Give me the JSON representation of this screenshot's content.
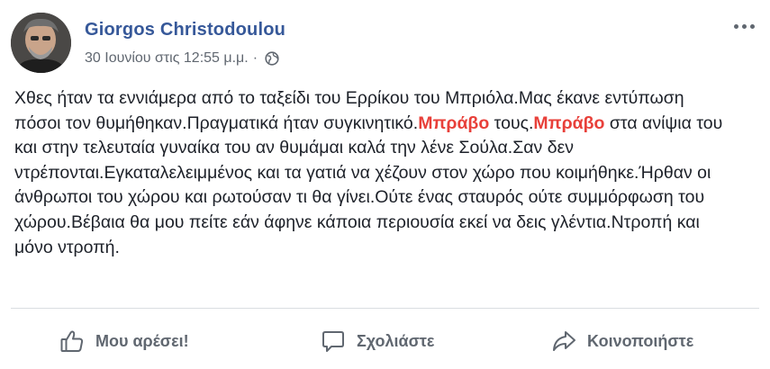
{
  "post": {
    "author": "Giorgos Christodoulou",
    "date": "30 Ιουνίου στις 12:55 μ.μ.",
    "separator": "·",
    "body": [
      {
        "text": "Χθες ήταν τα εννιάμερα από το ταξείδι του Ερρίκου του Μπριόλα.Μας έκανε εντύπωση πόσοι τον θυμήθηκαν.Πραγματικά ήταν συγκινητικό.",
        "highlight": false
      },
      {
        "text": "Μπράβο",
        "highlight": true
      },
      {
        "text": " τους.",
        "highlight": false
      },
      {
        "text": "Μπράβο",
        "highlight": true
      },
      {
        "text": " στα ανίψια του και στην τελευταία γυναίκα του αν θυμάμαι καλά την λένε Σούλα.Σαν δεν ντρέπονται.Εγκαταλελειμμένος και τα γατιά να χέζουν στον χώρο που κοιμήθηκε.Ήρθαν οι άνθρωποι του χώρου και ρωτούσαν τι θα γίνει.Ούτε ένας σταυρός ούτε συμμόρφωση του χώρου.Βέβαια θα μου πείτε εάν άφηνε κάποια περιουσία εκεί να δεις γλέντια.Ντροπή και μόνο ντροπή.",
        "highlight": false
      }
    ]
  },
  "icons": {
    "avatar": "avatar-photo",
    "privacy": "globe-icon",
    "options": "more-options-icon",
    "like": "thumbs-up-icon",
    "comment": "comment-icon",
    "share": "share-icon"
  },
  "actions": {
    "like_label": "Μου αρέσει!",
    "comment_label": "Σχολιάστε",
    "share_label": "Κοινοποιήστε"
  },
  "colors": {
    "author": "#365899",
    "highlight": "#e8403a",
    "muted": "#606770",
    "text": "#1d2129"
  }
}
